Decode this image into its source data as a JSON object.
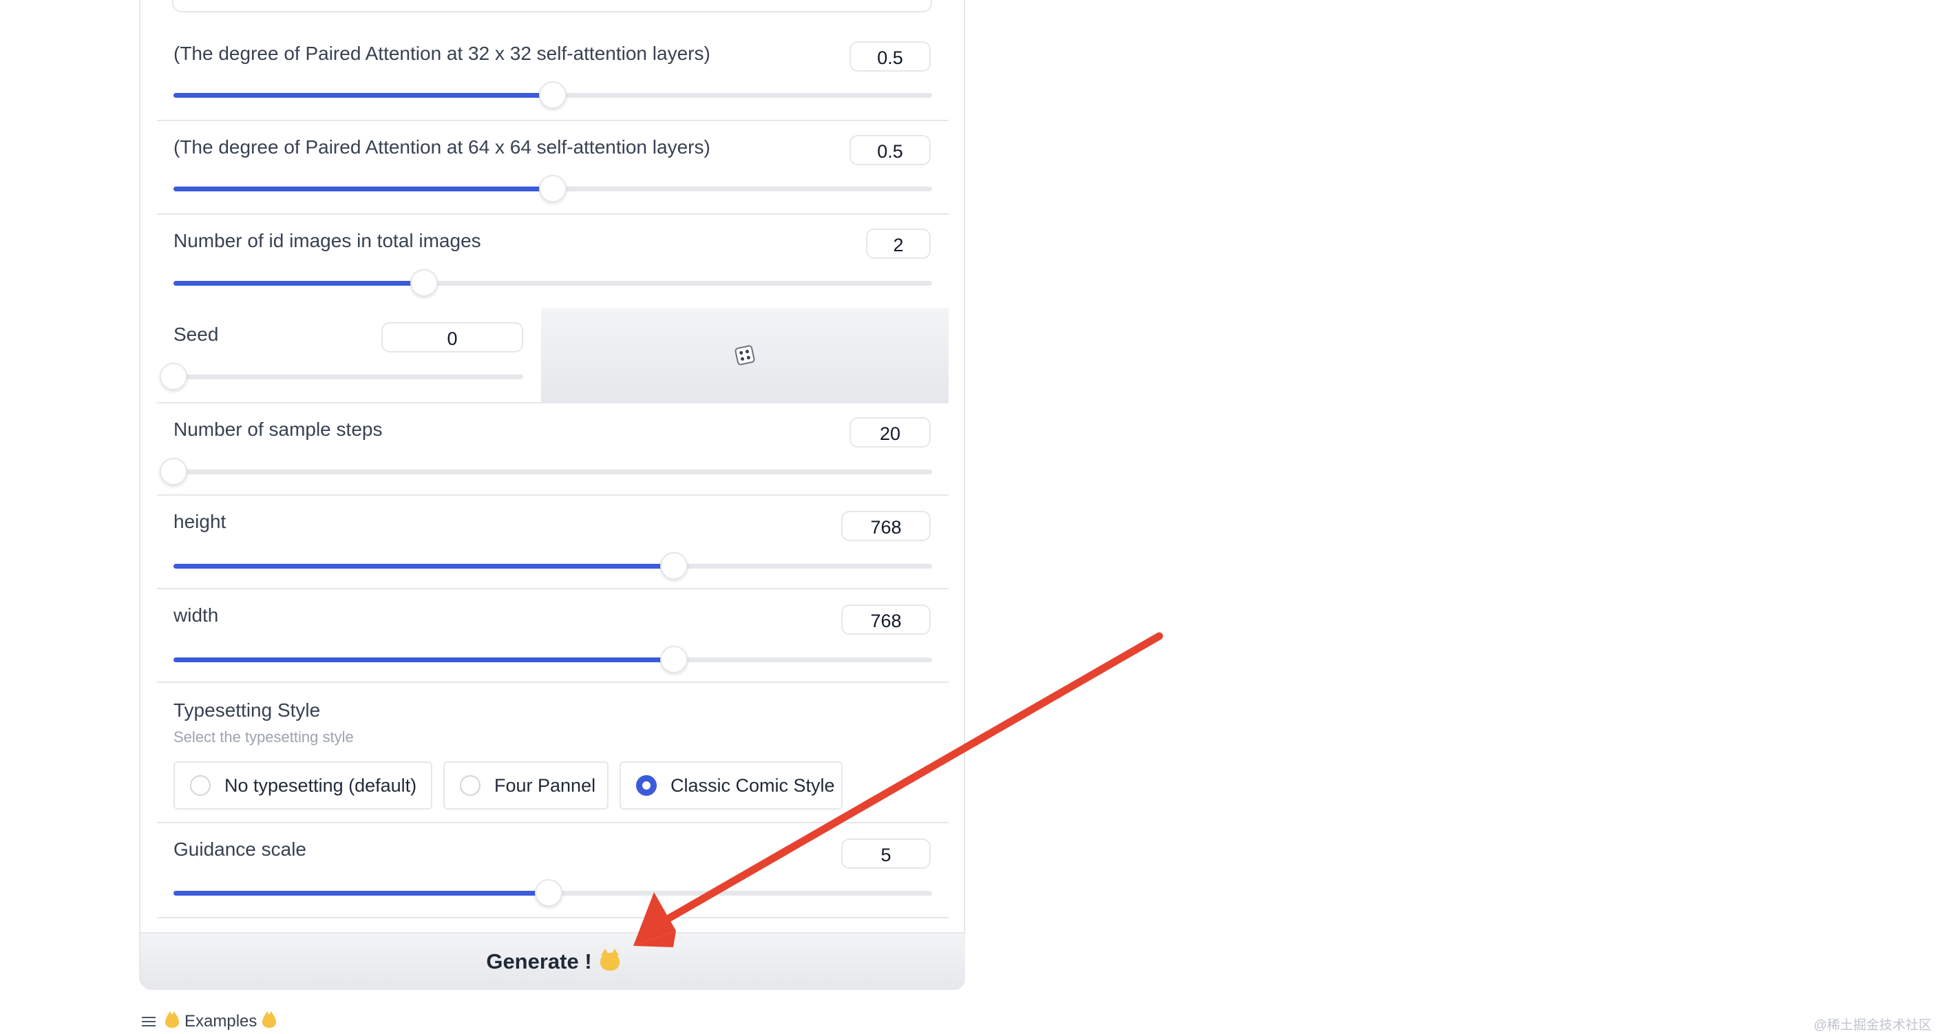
{
  "sliders": [
    {
      "label": "(The degree of Paired Attention at 32 x 32 self-attention layers)",
      "value": "0.5",
      "fraction": 0.5
    },
    {
      "label": "(The degree of Paired Attention at 64 x 64 self-attention layers)",
      "value": "0.5",
      "fraction": 0.5
    },
    {
      "label": "Number of id images in total images",
      "value": "2",
      "fraction": 0.33
    },
    {
      "label": "Seed",
      "value": "0",
      "fraction": 0.0
    },
    {
      "label": "Number of sample steps",
      "value": "20",
      "fraction": 0.0
    },
    {
      "label": "height",
      "value": "768",
      "fraction": 0.66
    },
    {
      "label": "width",
      "value": "768",
      "fraction": 0.66
    },
    {
      "label": "Guidance scale",
      "value": "5",
      "fraction": 0.495
    }
  ],
  "seed_button": {
    "icon": "dice-icon"
  },
  "typesetting": {
    "label": "Typesetting Style",
    "info": "Select the typesetting style",
    "options": [
      "No typesetting (default)",
      "Four Pannel",
      "Classic Comic Style"
    ],
    "selected": "Classic Comic Style"
  },
  "generate": {
    "label": "Generate !",
    "icon": "cat-face-icon"
  },
  "examples": {
    "label": "Examples",
    "icon": "list-icon"
  },
  "watermark": "@稀土掘金技术社区",
  "annotation": {
    "arrow_color": "#e5432f"
  },
  "colors": {
    "accent": "#3b5bdb",
    "border": "#e5e7eb"
  }
}
